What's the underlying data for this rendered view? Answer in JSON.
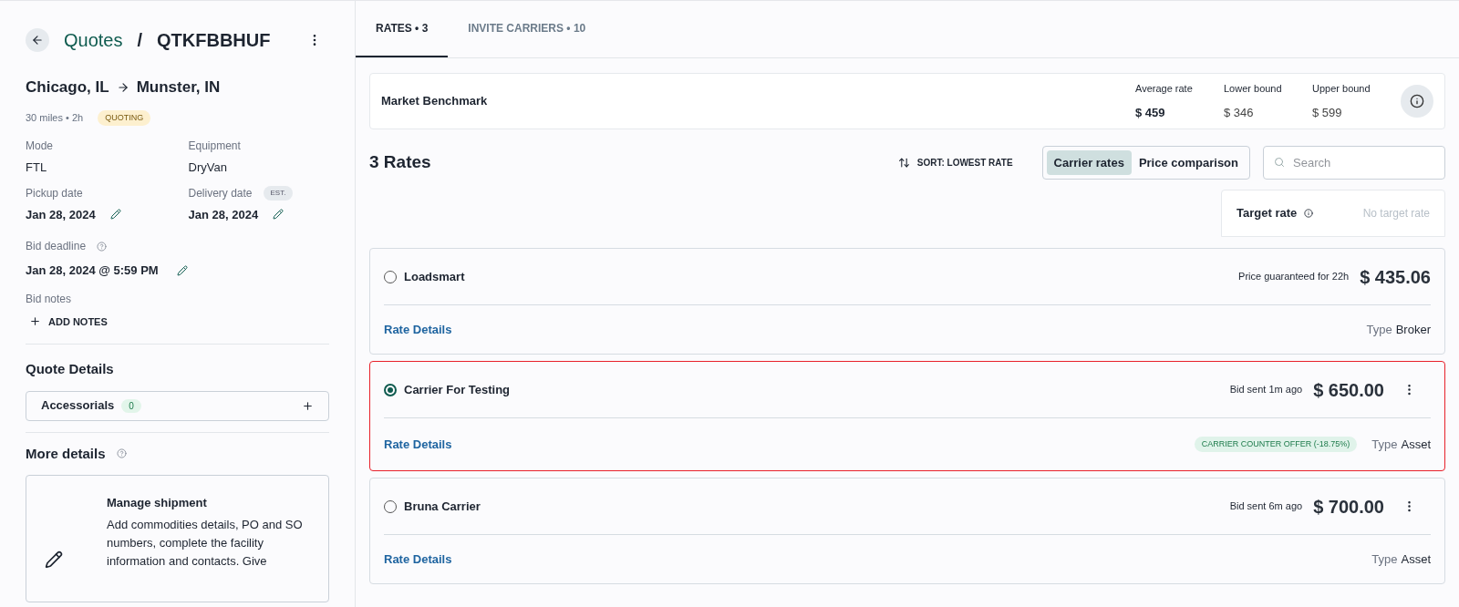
{
  "header": {
    "back": "Quotes",
    "separator": "/",
    "quote_id": "QTKFBBHUF"
  },
  "route": {
    "origin": "Chicago, IL",
    "destination": "Munster, IN",
    "summary": "30 miles • 2h",
    "status": "QUOTING"
  },
  "fields": [
    {
      "label": "Mode",
      "value": "FTL",
      "editable": false
    },
    {
      "label": "Equipment",
      "value": "DryVan",
      "editable": false
    },
    {
      "label": "Pickup date",
      "value": "Jan 28, 2024",
      "editable": true
    },
    {
      "label": "Delivery date",
      "badge": "EST.",
      "value": "Jan 28, 2024",
      "editable": true
    }
  ],
  "bid_deadline": {
    "label": "Bid deadline",
    "value": "Jan 28, 2024 @ 5:59 PM"
  },
  "bid_notes": {
    "label": "Bid notes",
    "action": "ADD NOTES"
  },
  "quote_details": {
    "title": "Quote Details",
    "accessorials": {
      "label": "Accessorials",
      "count": "0"
    }
  },
  "more_details": {
    "title": "More details",
    "card_title": "Manage shipment",
    "card_text": "Add commodities details, PO and SO numbers, complete the facility information and contacts. Give"
  },
  "tabs": [
    {
      "label": "RATES • 3",
      "selected": true
    },
    {
      "label": "INVITE CARRIERS • 10",
      "selected": false
    }
  ],
  "benchmark": {
    "title": "Market Benchmark",
    "stats": [
      {
        "label": "Average rate",
        "value": "$ 459",
        "bold": true
      },
      {
        "label": "Lower bound",
        "value": "$ 346",
        "bold": false
      },
      {
        "label": "Upper bound",
        "value": "$ 599",
        "bold": false
      }
    ]
  },
  "rates_title": "3 Rates",
  "sort": "SORT: LOWEST RATE",
  "view_toggle": [
    {
      "label": "Carrier rates",
      "selected": true
    },
    {
      "label": "Price comparison",
      "selected": false
    }
  ],
  "search": {
    "placeholder": "Search"
  },
  "target_rate": {
    "label": "Target rate",
    "value": "No target rate"
  },
  "rates": [
    {
      "carrier": "Loadsmart",
      "selected": false,
      "note": "Price guaranteed for 22h",
      "price": "$ 435.06",
      "menu": false,
      "link": "Rate Details",
      "type_label": "Type",
      "type": "Broker"
    },
    {
      "carrier": "Carrier For Testing",
      "selected": true,
      "note": "Bid sent 1m ago",
      "price": "$ 650.00",
      "menu": true,
      "link": "Rate Details",
      "badge": "CARRIER COUNTER OFFER (-18.75%)",
      "type_label": "Type",
      "type": "Asset"
    },
    {
      "carrier": "Bruna Carrier",
      "selected": false,
      "note": "Bid sent 6m ago",
      "price": "$ 700.00",
      "menu": true,
      "link": "Rate Details",
      "type_label": "Type",
      "type": "Asset"
    }
  ]
}
